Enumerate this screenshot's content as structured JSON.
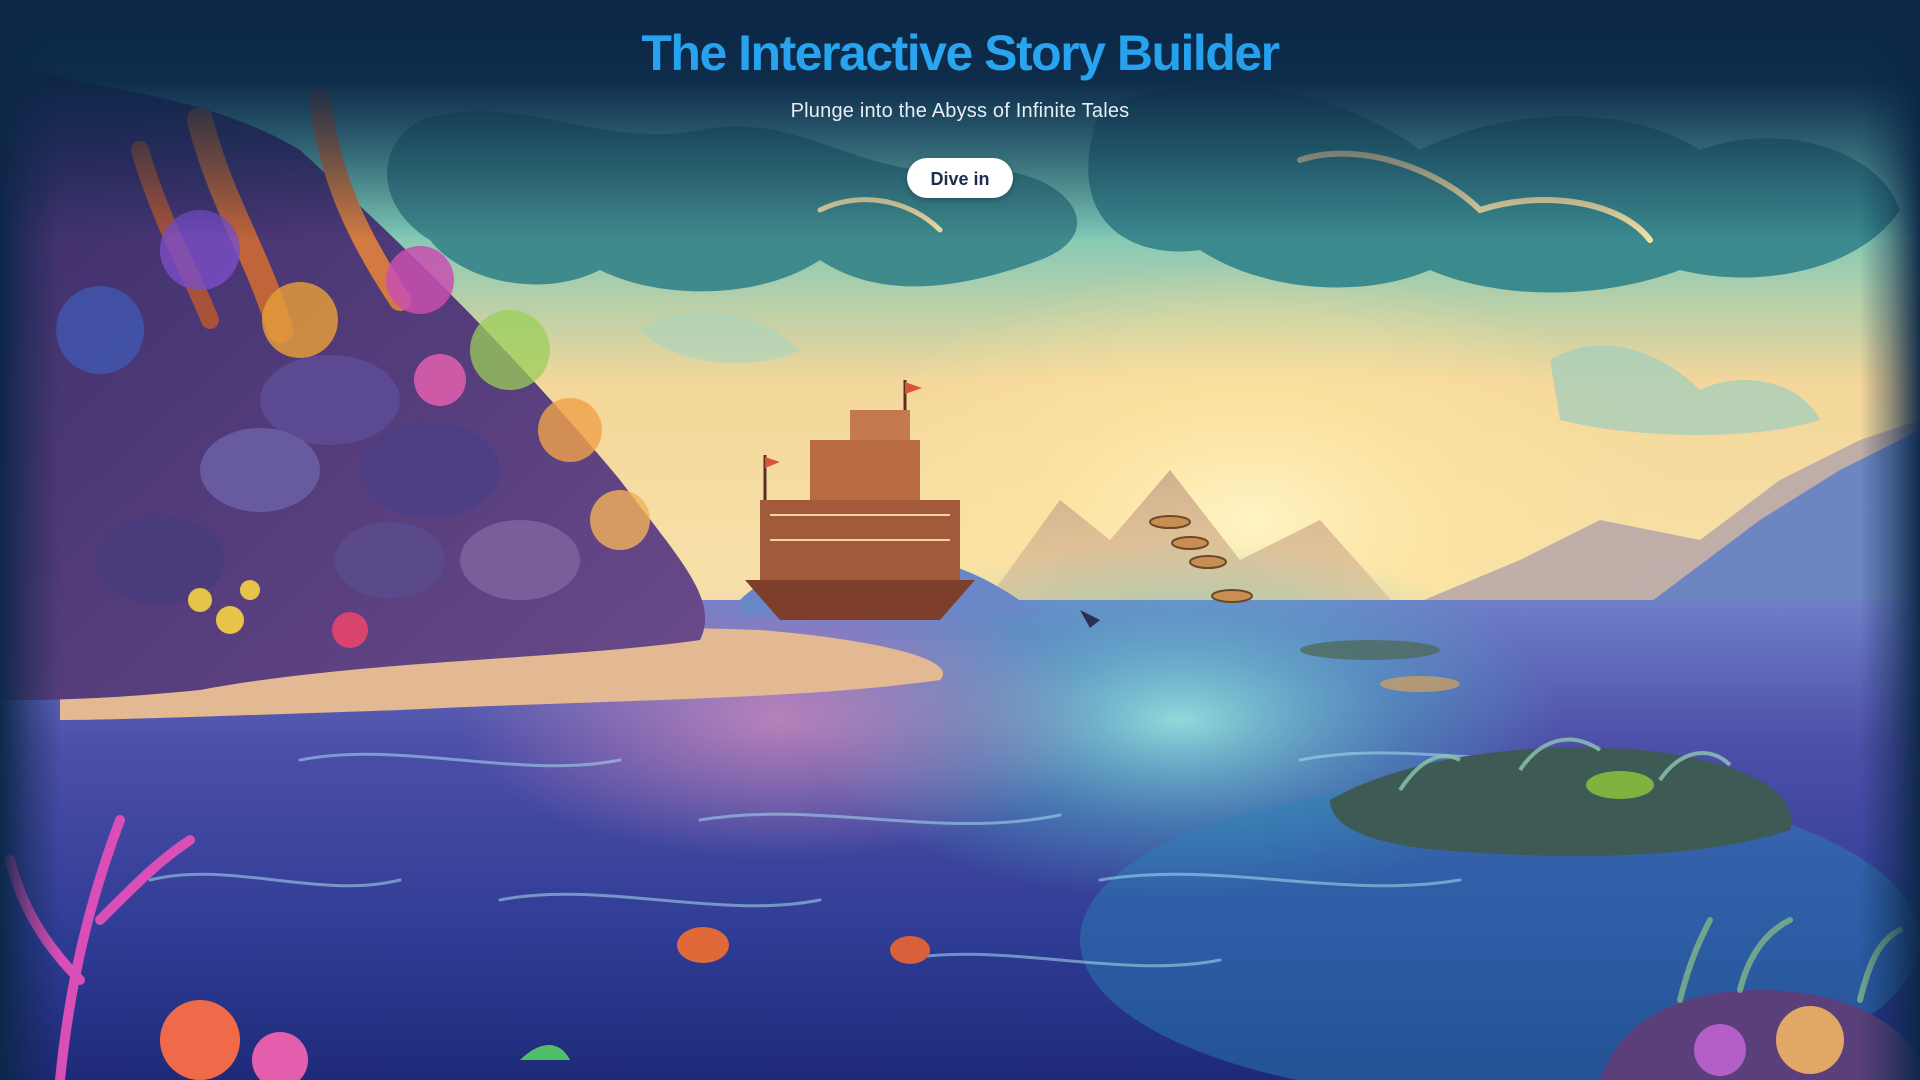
{
  "hero": {
    "title": "The Interactive Story Builder",
    "subtitle": "Plunge into the Abyss of Infinite Tales",
    "cta_label": "Dive in",
    "background_image": "illustrated fantasy seascape with ship, coral reef and sunset sky"
  },
  "colors": {
    "page_background": "#0c2746",
    "title_gradient": "#1e9be9",
    "subtitle_text": "#e8eef6",
    "button_background": "#ffffff",
    "button_text": "#1d2d4d"
  }
}
